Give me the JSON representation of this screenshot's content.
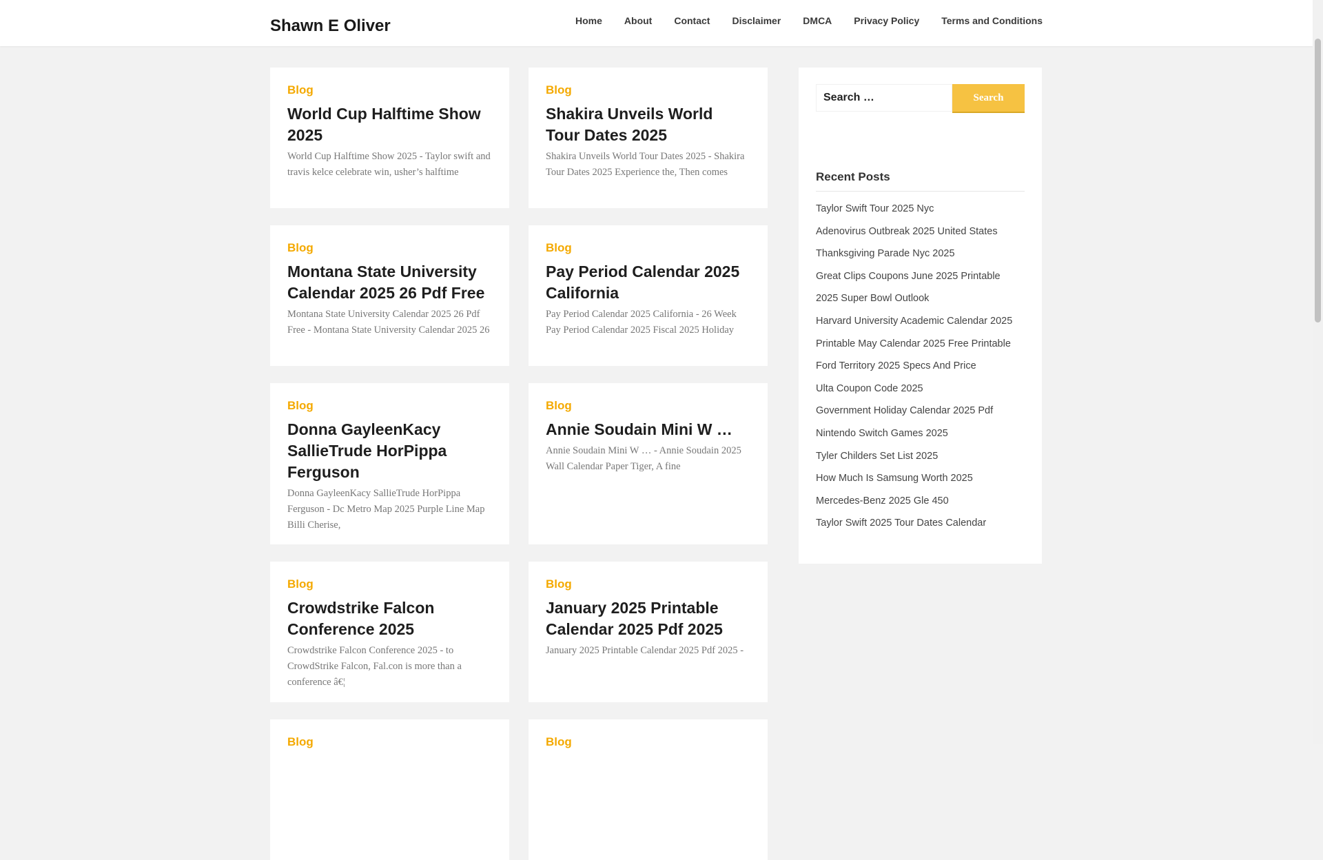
{
  "site": {
    "title": "Shawn E Oliver"
  },
  "nav": [
    "Home",
    "About",
    "Contact",
    "Disclaimer",
    "DMCA",
    "Privacy Policy",
    "Terms and Conditions"
  ],
  "posts": [
    {
      "category": "Blog",
      "title": "World Cup Halftime Show 2025",
      "excerpt": "World Cup Halftime Show 2025 - Taylor swift and travis kelce celebrate win, usher’s halftime"
    },
    {
      "category": "Blog",
      "title": "Shakira Unveils World Tour Dates 2025",
      "excerpt": "Shakira Unveils World Tour Dates 2025 - Shakira Tour Dates 2025 Experience the, Then comes"
    },
    {
      "category": "Blog",
      "title": "Montana State University Calendar 2025 26 Pdf Free",
      "excerpt": "Montana State University Calendar 2025 26 Pdf Free - Montana State University Calendar 2025 26"
    },
    {
      "category": "Blog",
      "title": "Pay Period Calendar 2025 California",
      "excerpt": "Pay Period Calendar 2025 California - 26 Week Pay Period Calendar 2025 Fiscal 2025 Holiday"
    },
    {
      "category": "Blog",
      "title": "Donna GayleenKacy SallieTrude HorPippa Ferguson",
      "excerpt": "Donna GayleenKacy SallieTrude HorPippa Ferguson - Dc Metro Map 2025 Purple Line Map Billi Cherise,"
    },
    {
      "category": "Blog",
      "title": "Annie Soudain Mini W …",
      "excerpt": "Annie Soudain Mini W … - Annie Soudain 2025 Wall Calendar Paper Tiger, A fine"
    },
    {
      "category": "Blog",
      "title": "Crowdstrike Falcon Conference 2025",
      "excerpt": "Crowdstrike Falcon Conference 2025 - to CrowdStrike Falcon, Fal.con is more than a conference â€¦"
    },
    {
      "category": "Blog",
      "title": "January 2025 Printable Calendar 2025 Pdf 2025",
      "excerpt": "January 2025 Printable Calendar 2025 Pdf 2025 -"
    },
    {
      "category": "Blog",
      "title": "",
      "excerpt": ""
    },
    {
      "category": "Blog",
      "title": "",
      "excerpt": ""
    }
  ],
  "search": {
    "placeholder": "Search …",
    "button_label": "Search"
  },
  "recent_posts": {
    "title": "Recent Posts",
    "items": [
      "Taylor Swift Tour 2025 Nyc",
      "Adenovirus Outbreak 2025 United States",
      "Thanksgiving Parade Nyc 2025",
      "Great Clips Coupons June 2025 Printable",
      "2025 Super Bowl Outlook",
      "Harvard University Academic Calendar 2025",
      "Printable May Calendar 2025 Free Printable",
      "Ford Territory 2025 Specs And Price",
      "Ulta Coupon Code 2025",
      "Government Holiday Calendar 2025 Pdf",
      "Nintendo Switch Games 2025",
      "Tyler Childers Set List 2025",
      "How Much Is Samsung Worth 2025",
      "Mercedes-Benz 2025 Gle 450",
      "Taylor Swift 2025 Tour Dates Calendar"
    ]
  },
  "colors": {
    "accent": "#f4a900",
    "button": "#f6c242",
    "background": "#f2f2f2"
  }
}
